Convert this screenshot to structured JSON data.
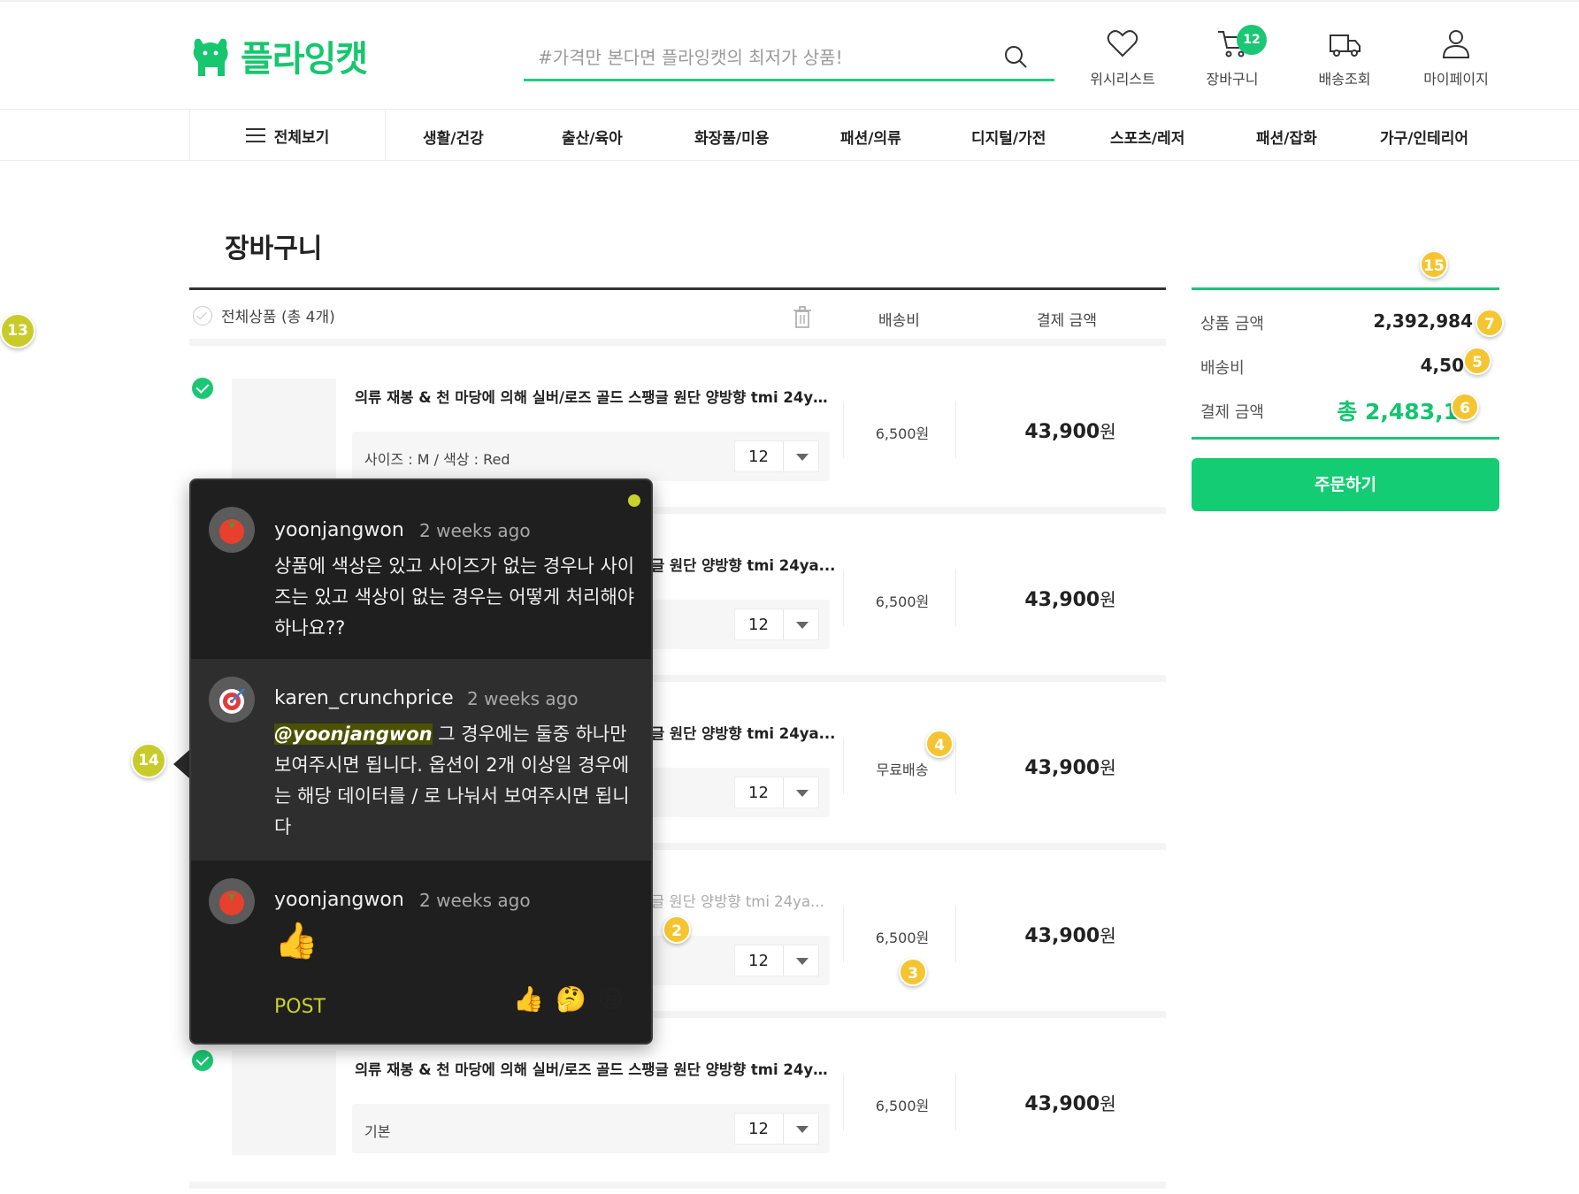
{
  "header": {
    "brand": "플라잉캣",
    "search_placeholder": "#가격만 본다면 플라잉캣의 최저가 상품!",
    "items": [
      {
        "label": "위시리스트",
        "icon": "heart-icon"
      },
      {
        "label": "장바구니",
        "icon": "cart-icon",
        "badge": "12"
      },
      {
        "label": "배송조회",
        "icon": "truck-icon"
      },
      {
        "label": "마이페이지",
        "icon": "user-icon"
      }
    ]
  },
  "nav": {
    "all_label": "전체보기",
    "items": [
      "생활/건강",
      "출산/육아",
      "화장품/미용",
      "패션/의류",
      "디지털/가전",
      "스포츠/레저",
      "패션/잡화",
      "가구/인테리어"
    ]
  },
  "cart": {
    "title": "장바구니",
    "select_all": "전체상품 (총 4개)",
    "col_shipping": "배송비",
    "col_price": "결제 금액",
    "rows": [
      {
        "name": "의류 재봉 & 천 마당에 의해 실버/로즈 골드 스팽글 원단 양방향 tmi 24ya...",
        "option": "사이즈 : M / 색상 : Red",
        "qty": "12",
        "shipping": "6,500원",
        "price": "43,900",
        "unit": "원"
      },
      {
        "name": "글 원단 양방향 tmi 24ya...",
        "option": "",
        "qty": "12",
        "shipping": "6,500원",
        "price": "43,900",
        "unit": "원"
      },
      {
        "name": "글 원단 양방향 tmi 24ya...",
        "option": "",
        "qty": "12",
        "shipping": "무료배송",
        "price": "43,900",
        "unit": "원"
      },
      {
        "name": "글 원단 양방향 tmi 24ya...",
        "option": "",
        "qty": "12",
        "shipping": "6,500원",
        "price": "43,900",
        "unit": "원"
      },
      {
        "name": "의류 재봉 & 천 마당에 의해 실버/로즈 골드 스팽글 원단 양방향 tmi 24ya...",
        "option": "기본",
        "qty": "12",
        "shipping": "6,500원",
        "price": "43,900",
        "unit": "원"
      }
    ]
  },
  "summary": {
    "product_label": "상품 금액",
    "product_value": "2,392,984",
    "shipping_label": "배송비",
    "shipping_value": "4,50",
    "total_label": "결제 금액",
    "total_value": "총 2,483,1",
    "total_tail": "",
    "order_button": "주문하기"
  },
  "badges": [
    "15",
    "7",
    "5",
    "6",
    "4",
    "2",
    "3",
    "13",
    "14"
  ],
  "comments": {
    "thread": [
      {
        "user": "yoonjangwon",
        "time": "2 weeks ago",
        "text": "상품에 색상은 있고 사이즈가 없는 경우나 사이즈는 있고 색상이 없는 경우는 어떻게 처리해야 하나요??"
      },
      {
        "user": "karen_crunchprice",
        "time": "2 weeks ago",
        "mention": "@yoonjangwon",
        "text": " 그 경우에는 둘중 하나만 보여주시면 됩니다. 옵션이 2개 이상일 경우에는 해당 데이터를 / 로 나눠서 보여주시면 됩니다"
      },
      {
        "user": "yoonjangwon",
        "time": "2 weeks ago",
        "text": "👍"
      }
    ],
    "post_label": "POST",
    "reactions": [
      "👍",
      "🤔",
      "😩"
    ]
  },
  "colors": {
    "brand": "#17c76e",
    "badge": "#f5c531",
    "popover": "#1f1f1f",
    "accent": "#c9d12b"
  }
}
